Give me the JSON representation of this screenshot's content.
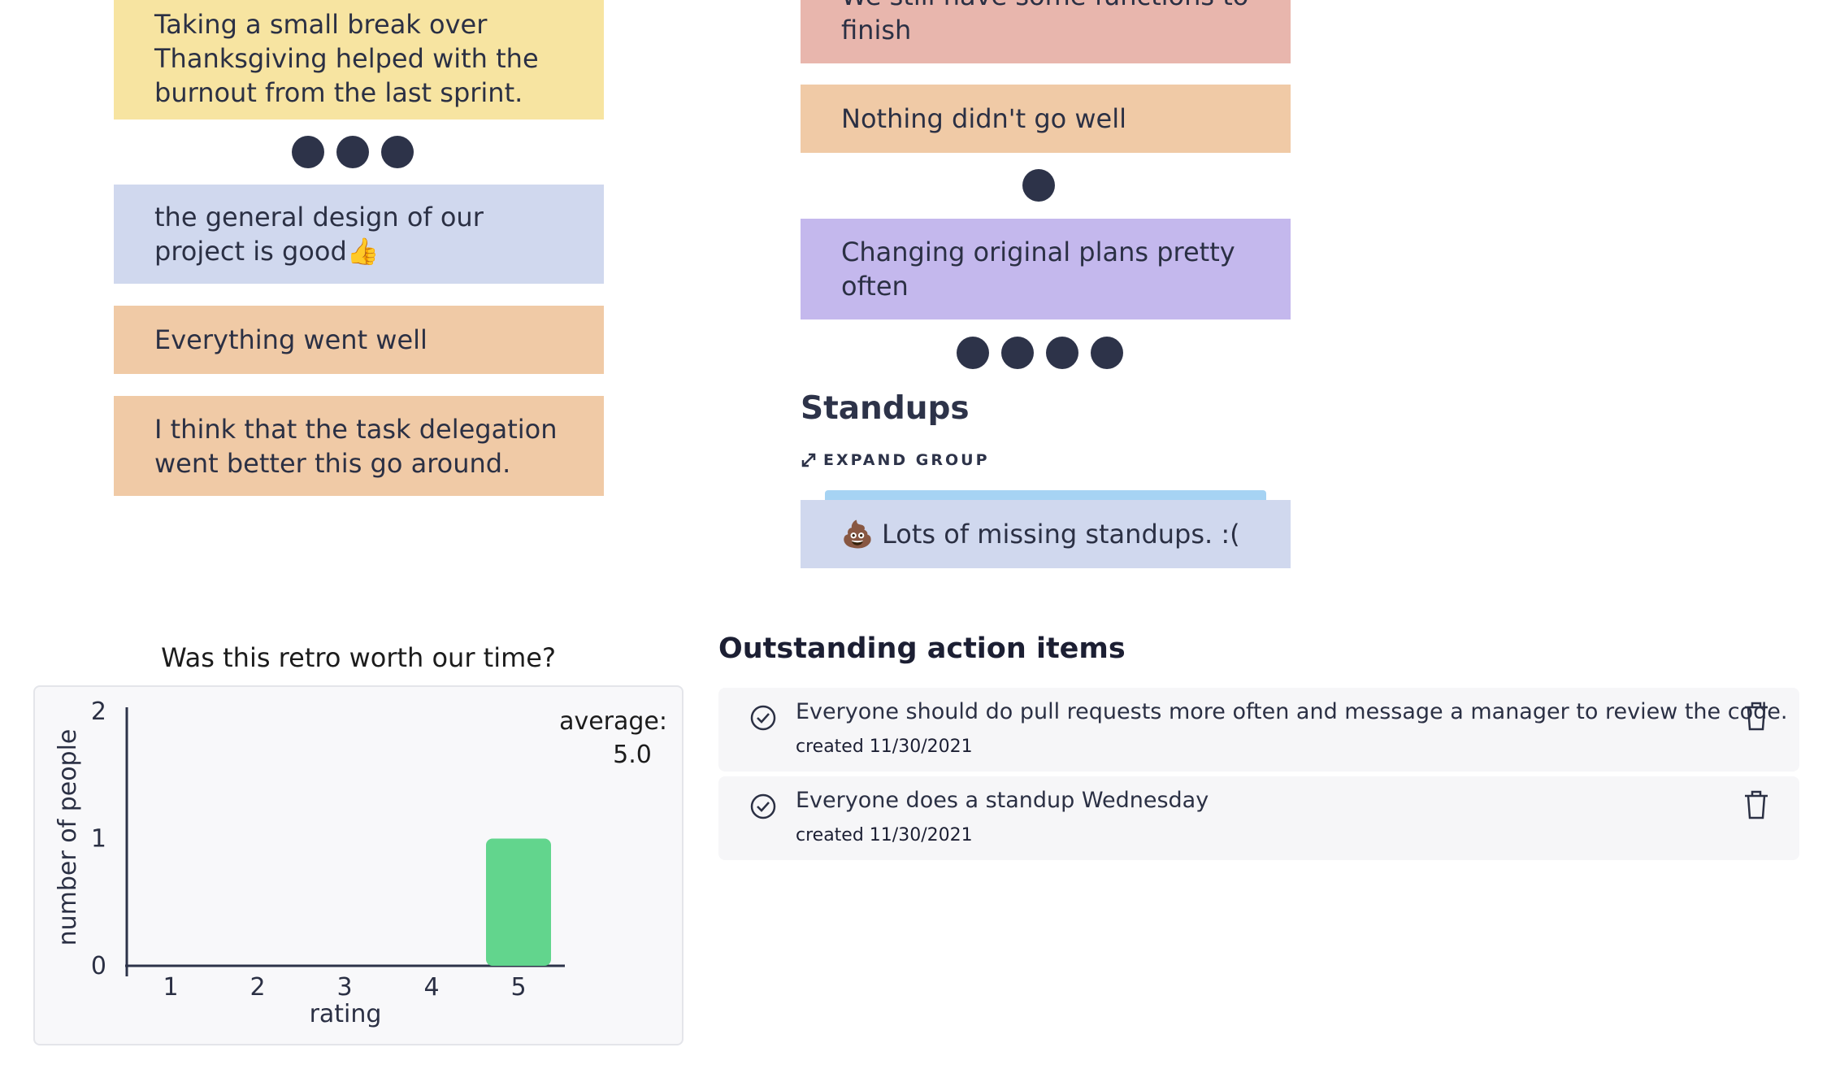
{
  "left_column": {
    "cards": [
      {
        "text": "Taking a small break over Thanksgiving helped with the burnout from the last sprint.",
        "color": "#f7e4a1"
      },
      {
        "text": "the general design of our project is good👍",
        "color": "#d0d8ee"
      },
      {
        "text": "Everything went well",
        "color": "#f0caa6"
      },
      {
        "text": "I think that the task delegation went better this go around.",
        "color": "#f0caa6"
      }
    ],
    "vote_counts": [
      3
    ]
  },
  "right_column": {
    "cards": [
      {
        "text": "We still have some functions to finish",
        "color": "#e8b6ad"
      },
      {
        "text": "Nothing didn't go well",
        "color": "#f0caa6"
      },
      {
        "text": "Changing original plans pretty often",
        "color": "#c4b8ed"
      }
    ],
    "vote_counts": [
      1,
      4
    ],
    "group": {
      "title": "Standups",
      "expand_label": "EXPAND GROUP",
      "expand_icon": "expand-arrows-icon",
      "card": {
        "text": "💩 Lots of missing standups. :(",
        "color": "#d0d8ee",
        "accent": "#a6d3f3"
      }
    }
  },
  "chart_data": {
    "type": "bar",
    "title": "Was this retro worth our time?",
    "categories": [
      "1",
      "2",
      "3",
      "4",
      "5"
    ],
    "values": [
      0,
      0,
      0,
      0,
      1
    ],
    "xlabel": "rating",
    "ylabel": "number of people",
    "ylim": [
      0,
      2
    ],
    "yticks": [
      "0",
      "1",
      "2"
    ],
    "average_label": "average:",
    "average_value": "5.0",
    "bar_color": "#62d58d",
    "grid": false
  },
  "action_items": {
    "heading": "Outstanding action items",
    "items": [
      {
        "text": "Everyone should do pull requests more often and message a manager to review the code.",
        "created": "created 11/30/2021"
      },
      {
        "text": "Everyone does a standup Wednesday",
        "created": "created 11/30/2021"
      }
    ]
  }
}
